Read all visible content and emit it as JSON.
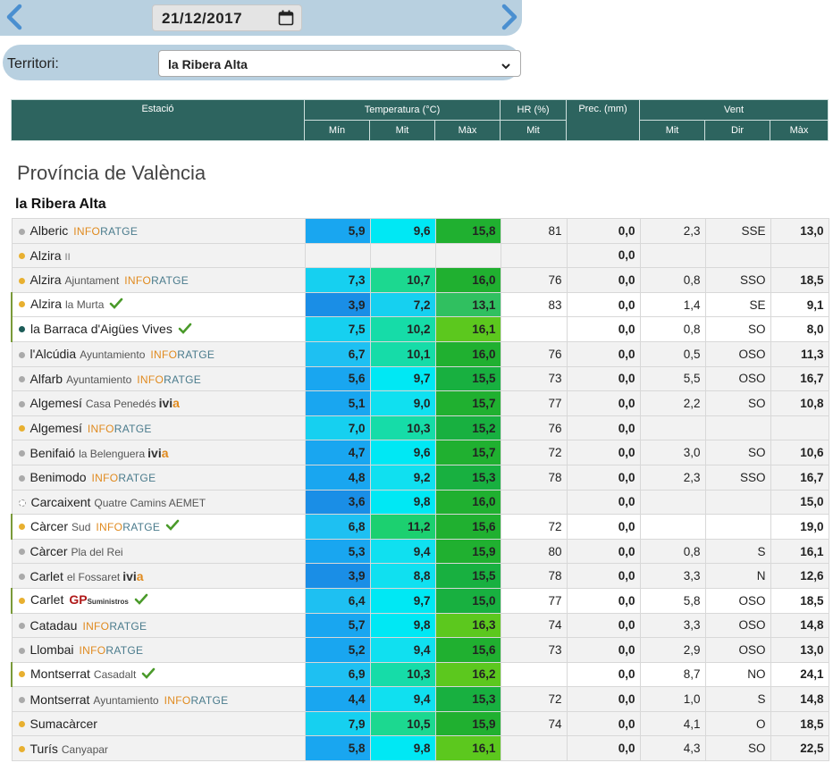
{
  "date": {
    "value": "21/12/2017"
  },
  "territory": {
    "label": "Territori:",
    "selected": "la Ribera Alta"
  },
  "header": {
    "station": "Estació",
    "temperature": "Temperatura (°C)",
    "hr": "HR (%)",
    "prec": "Prec. (mm)",
    "wind": "Vent",
    "min": "Mín",
    "mit": "Mit",
    "max": "Màx",
    "hr_mit": "Mit",
    "wind_mit": "Mit",
    "wind_dir": "Dir",
    "wind_max": "Màx"
  },
  "province": "Província de València",
  "region": "la Ribera Alta",
  "colors": {
    "header_bg": "#2d645f",
    "dot_yellow": "#e8b030",
    "dot_gray": "#aaaaaa",
    "dot_teal": "#1d5c58",
    "check": "#4a9a2a"
  },
  "rows": [
    {
      "name": "Alberic",
      "sub": "",
      "logo": "inforatge",
      "dot": "gray",
      "valid": false,
      "min": "5,9",
      "mit": "9,6",
      "max": "15,8",
      "hr": "81",
      "prec": "0,0",
      "wmit": "2,3",
      "dir": "SSE",
      "wmax": "13,0"
    },
    {
      "name": "Alzira",
      "sub": "",
      "logo": "ii",
      "dot": "yellow",
      "valid": false,
      "min": "",
      "mit": "",
      "max": "",
      "hr": "",
      "prec": "0,0",
      "wmit": "",
      "dir": "",
      "wmax": ""
    },
    {
      "name": "Alzira",
      "sub": "Ajuntament",
      "logo": "inforatge",
      "dot": "yellow",
      "valid": false,
      "min": "7,3",
      "mit": "10,7",
      "max": "16,0",
      "hr": "76",
      "prec": "0,0",
      "wmit": "0,8",
      "dir": "SSO",
      "wmax": "18,5"
    },
    {
      "name": "Alzira",
      "sub": "la Murta",
      "logo": "",
      "dot": "yellow",
      "valid": true,
      "min": "3,9",
      "mit": "7,2",
      "max": "13,1",
      "hr": "83",
      "prec": "0,0",
      "wmit": "1,4",
      "dir": "SE",
      "wmax": "9,1"
    },
    {
      "name": "la Barraca d'Aigües Vives",
      "sub": "",
      "logo": "",
      "dot": "teal",
      "valid": true,
      "min": "7,5",
      "mit": "10,2",
      "max": "16,1",
      "hr": "",
      "prec": "0,0",
      "wmit": "0,8",
      "dir": "SO",
      "wmax": "8,0"
    },
    {
      "name": "l'Alcúdia",
      "sub": "Ayuntamiento",
      "logo": "inforatge",
      "dot": "gray",
      "valid": false,
      "min": "6,7",
      "mit": "10,1",
      "max": "16,0",
      "hr": "76",
      "prec": "0,0",
      "wmit": "0,5",
      "dir": "OSO",
      "wmax": "11,3"
    },
    {
      "name": "Alfarb",
      "sub": "Ayuntamiento",
      "logo": "inforatge",
      "dot": "gray",
      "valid": false,
      "min": "5,6",
      "mit": "9,7",
      "max": "15,5",
      "hr": "73",
      "prec": "0,0",
      "wmit": "5,5",
      "dir": "OSO",
      "wmax": "16,7"
    },
    {
      "name": "Algemesí",
      "sub": "Casa Penedés",
      "logo": "ivia",
      "dot": "gray",
      "valid": false,
      "min": "5,1",
      "mit": "9,0",
      "max": "15,7",
      "hr": "77",
      "prec": "0,0",
      "wmit": "2,2",
      "dir": "SO",
      "wmax": "10,8"
    },
    {
      "name": "Algemesí",
      "sub": "",
      "logo": "inforatge",
      "dot": "yellow",
      "valid": false,
      "min": "7,0",
      "mit": "10,3",
      "max": "15,2",
      "hr": "76",
      "prec": "0,0",
      "wmit": "",
      "dir": "",
      "wmax": ""
    },
    {
      "name": "Benifaió",
      "sub": "la Belenguera",
      "logo": "ivia",
      "dot": "gray",
      "valid": false,
      "min": "4,7",
      "mit": "9,6",
      "max": "15,7",
      "hr": "72",
      "prec": "0,0",
      "wmit": "3,0",
      "dir": "SO",
      "wmax": "10,6"
    },
    {
      "name": "Benimodo",
      "sub": "",
      "logo": "inforatge",
      "dot": "gray",
      "valid": false,
      "min": "4,8",
      "mit": "9,2",
      "max": "15,3",
      "hr": "78",
      "prec": "0,0",
      "wmit": "2,3",
      "dir": "SSO",
      "wmax": "16,7"
    },
    {
      "name": "Carcaixent",
      "sub": "Quatre Camins AEMET",
      "logo": "",
      "dot": "dashed",
      "valid": false,
      "min": "3,6",
      "mit": "9,8",
      "max": "16,0",
      "hr": "",
      "prec": "0,0",
      "wmit": "",
      "dir": "",
      "wmax": "15,0"
    },
    {
      "name": "Càrcer",
      "sub": "Sud",
      "logo": "inforatge",
      "dot": "yellow",
      "valid": true,
      "min": "6,8",
      "mit": "11,2",
      "max": "15,6",
      "hr": "72",
      "prec": "0,0",
      "wmit": "",
      "dir": "",
      "wmax": "19,0"
    },
    {
      "name": "Càrcer",
      "sub": "Pla del Rei",
      "logo": "",
      "dot": "gray",
      "valid": false,
      "min": "5,3",
      "mit": "9,4",
      "max": "15,9",
      "hr": "80",
      "prec": "0,0",
      "wmit": "0,8",
      "dir": "S",
      "wmax": "16,1"
    },
    {
      "name": "Carlet",
      "sub": "el Fossaret",
      "logo": "ivia",
      "dot": "gray",
      "valid": false,
      "min": "3,9",
      "mit": "8,8",
      "max": "15,5",
      "hr": "78",
      "prec": "0,0",
      "wmit": "3,3",
      "dir": "N",
      "wmax": "12,6"
    },
    {
      "name": "Carlet",
      "sub": "",
      "logo": "gp",
      "dot": "yellow",
      "valid": true,
      "min": "6,4",
      "mit": "9,7",
      "max": "15,0",
      "hr": "77",
      "prec": "0,0",
      "wmit": "5,8",
      "dir": "OSO",
      "wmax": "18,5"
    },
    {
      "name": "Catadau",
      "sub": "",
      "logo": "inforatge",
      "dot": "gray",
      "valid": false,
      "min": "5,7",
      "mit": "9,8",
      "max": "16,3",
      "hr": "74",
      "prec": "0,0",
      "wmit": "3,3",
      "dir": "OSO",
      "wmax": "14,8"
    },
    {
      "name": "Llombai",
      "sub": "",
      "logo": "inforatge",
      "dot": "gray",
      "valid": false,
      "min": "5,2",
      "mit": "9,4",
      "max": "15,6",
      "hr": "73",
      "prec": "0,0",
      "wmit": "2,9",
      "dir": "OSO",
      "wmax": "13,0"
    },
    {
      "name": "Montserrat",
      "sub": "Casadalt",
      "logo": "",
      "dot": "yellow",
      "valid": true,
      "min": "6,9",
      "mit": "10,3",
      "max": "16,2",
      "hr": "",
      "prec": "0,0",
      "wmit": "8,7",
      "dir": "NO",
      "wmax": "24,1"
    },
    {
      "name": "Montserrat",
      "sub": "Ayuntamiento",
      "logo": "inforatge",
      "dot": "gray",
      "valid": false,
      "min": "4,4",
      "mit": "9,4",
      "max": "15,3",
      "hr": "72",
      "prec": "0,0",
      "wmit": "1,0",
      "dir": "S",
      "wmax": "14,8"
    },
    {
      "name": "Sumacàrcer",
      "sub": "",
      "logo": "",
      "dot": "yellow",
      "valid": false,
      "min": "7,9",
      "mit": "10,5",
      "max": "15,9",
      "hr": "74",
      "prec": "0,0",
      "wmit": "4,1",
      "dir": "O",
      "wmax": "18,5"
    },
    {
      "name": "Turís",
      "sub": "Canyapar",
      "logo": "",
      "dot": "yellow",
      "valid": false,
      "min": "5,8",
      "mit": "9,8",
      "max": "16,1",
      "hr": "",
      "prec": "0,0",
      "wmit": "4,3",
      "dir": "SO",
      "wmax": "22,5"
    }
  ]
}
